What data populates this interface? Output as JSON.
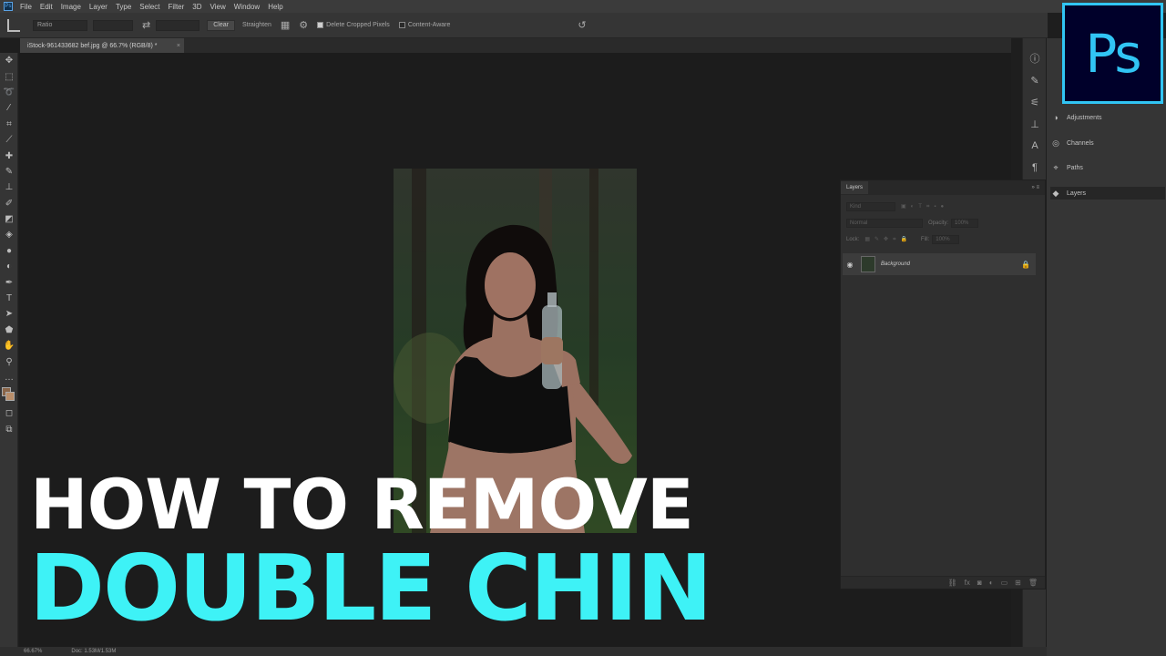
{
  "menubar": {
    "app_icon": "ps-app-icon",
    "items": [
      "File",
      "Edit",
      "Image",
      "Layer",
      "Type",
      "Select",
      "Filter",
      "3D",
      "View",
      "Window",
      "Help"
    ]
  },
  "options": {
    "tool_icon": "crop-icon",
    "ratio": "Ratio",
    "swap_icon": "swap-icon",
    "clear": "Clear",
    "straighten": "Straighten",
    "overlay_icon": "grid-icon",
    "settings_icon": "gear-icon",
    "delete_cropped": "Delete Cropped Pixels",
    "content_aware": "Content-Aware",
    "reset_icon": "reset-icon"
  },
  "document": {
    "tab_title": "iStock-961433682 bef.jpg @ 66.7% (RGB/8) *",
    "close": "×"
  },
  "toolbar": {
    "tools": [
      "move",
      "marquee",
      "lasso",
      "magic-wand",
      "crop",
      "eyedropper",
      "healing",
      "brush",
      "clone-stamp",
      "history-brush",
      "eraser",
      "paint-bucket",
      "blur",
      "dodge",
      "pen",
      "type",
      "path-select",
      "shape",
      "hand",
      "zoom",
      "more"
    ],
    "foreground_color": "#8a6548",
    "background_color": "#b98e6a"
  },
  "status": {
    "zoom": "66.67%",
    "doc": "Doc: 1.53M/1.53M"
  },
  "right_panels": {
    "items": [
      {
        "label": "Adjustments",
        "icon": "adjustments-icon"
      },
      {
        "label": "Channels",
        "icon": "channels-icon"
      },
      {
        "label": "Paths",
        "icon": "paths-icon"
      },
      {
        "label": "Layers",
        "icon": "layers-icon"
      }
    ]
  },
  "layers_panel": {
    "title": "Layers",
    "kind": "Kind",
    "blend_mode": "Normal",
    "opacity_label": "Opacity:",
    "opacity": "100%",
    "lock_label": "Lock:",
    "fill_label": "Fill:",
    "fill": "100%",
    "layer_name": "Background"
  },
  "ps_badge": "Ps",
  "headline": {
    "line1": "HOW TO REMOVE",
    "line2": "DOUBLE CHIN"
  },
  "colors": {
    "accent": "#3ef2f6",
    "ps_blue": "#31c5f4",
    "ps_dark": "#00002a"
  }
}
